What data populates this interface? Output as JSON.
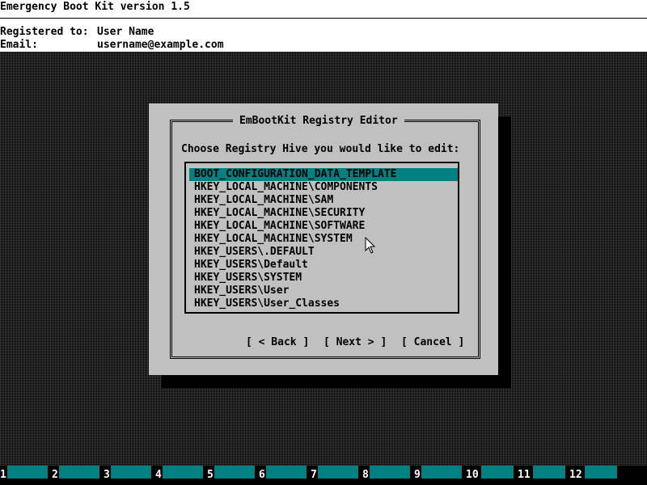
{
  "header": {
    "title": "Emergency Boot Kit version 1.5",
    "registered_to_label": "Registered to:",
    "registered_to_value": "User Name",
    "email_label": "Email:",
    "email_value": "username@example.com"
  },
  "dialog": {
    "title": "EmBootKit Registry Editor",
    "prompt": "Choose Registry Hive you would like to edit:",
    "hives": [
      "BOOT_CONFIGURATION_DATA_TEMPLATE",
      "HKEY_LOCAL_MACHINE\\COMPONENTS",
      "HKEY_LOCAL_MACHINE\\SAM",
      "HKEY_LOCAL_MACHINE\\SECURITY",
      "HKEY_LOCAL_MACHINE\\SOFTWARE",
      "HKEY_LOCAL_MACHINE\\SYSTEM",
      "HKEY_USERS\\.DEFAULT",
      "HKEY_USERS\\Default",
      "HKEY_USERS\\SYSTEM",
      "HKEY_USERS\\User",
      "HKEY_USERS\\User_Classes"
    ],
    "selected_index": 0,
    "buttons": {
      "back": "[ < Back ]",
      "next": "[ Next > ]",
      "cancel": "[ Cancel ]"
    }
  },
  "function_keys": [
    "1",
    "2",
    "3",
    "4",
    "5",
    "6",
    "7",
    "8",
    "9",
    "10",
    "11",
    "12"
  ],
  "colors": {
    "background": "#000000",
    "header_bg": "#ffffff",
    "dialog_bg": "#c0c0c0",
    "highlight": "#008080",
    "fkey_bar": "#008080"
  }
}
